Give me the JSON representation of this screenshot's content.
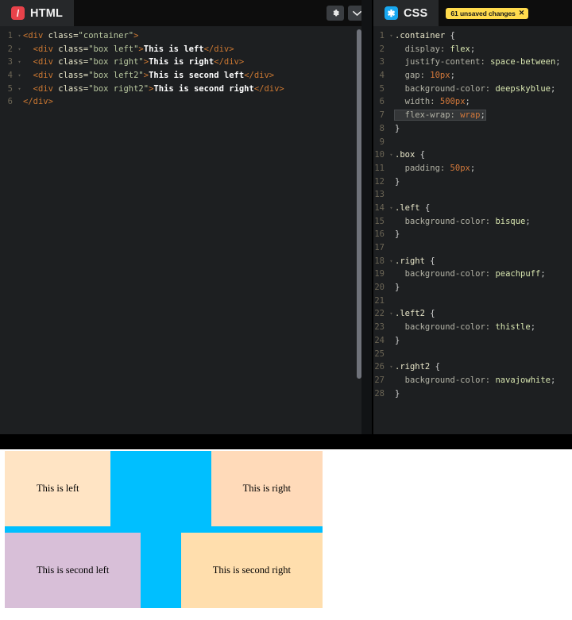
{
  "editors": {
    "html_panel": {
      "tab_label": "HTML",
      "logo_glyph": "/",
      "buttons": [
        {
          "name": "settings",
          "icon": "gear-icon"
        },
        {
          "name": "collapse",
          "icon": "chevron-down-icon"
        }
      ],
      "lines": [
        {
          "num": "1",
          "fold": "▾",
          "tokens": [
            {
              "cls": "t-tag",
              "text": "<div "
            },
            {
              "cls": "t-attr",
              "text": "class="
            },
            {
              "cls": "t-string",
              "text": "\"container\""
            },
            {
              "cls": "t-tag",
              "text": ">"
            }
          ]
        },
        {
          "num": "2",
          "fold": "▾",
          "tokens": [
            {
              "cls": "t-tag",
              "text": "  <div "
            },
            {
              "cls": "t-attr",
              "text": "class="
            },
            {
              "cls": "t-string",
              "text": "\"box left\""
            },
            {
              "cls": "t-tag",
              "text": ">"
            },
            {
              "cls": "t-text",
              "text": "This is left"
            },
            {
              "cls": "t-tag",
              "text": "</div>"
            }
          ]
        },
        {
          "num": "3",
          "fold": "▾",
          "tokens": [
            {
              "cls": "t-tag",
              "text": "  <div "
            },
            {
              "cls": "t-attr",
              "text": "class="
            },
            {
              "cls": "t-string",
              "text": "\"box right\""
            },
            {
              "cls": "t-tag",
              "text": ">"
            },
            {
              "cls": "t-text",
              "text": "This is right"
            },
            {
              "cls": "t-tag",
              "text": "</div>"
            }
          ]
        },
        {
          "num": "4",
          "fold": "▾",
          "tokens": [
            {
              "cls": "t-tag",
              "text": "  <div "
            },
            {
              "cls": "t-attr",
              "text": "class="
            },
            {
              "cls": "t-string",
              "text": "\"box left2\""
            },
            {
              "cls": "t-tag",
              "text": ">"
            },
            {
              "cls": "t-text",
              "text": "This is second left"
            },
            {
              "cls": "t-tag",
              "text": "</div>"
            }
          ]
        },
        {
          "num": "5",
          "fold": "▾",
          "tokens": [
            {
              "cls": "t-tag",
              "text": "  <div "
            },
            {
              "cls": "t-attr",
              "text": "class="
            },
            {
              "cls": "t-string",
              "text": "\"box right2\""
            },
            {
              "cls": "t-tag",
              "text": ">"
            },
            {
              "cls": "t-text",
              "text": "This is second right"
            },
            {
              "cls": "t-tag",
              "text": "</div>"
            }
          ]
        },
        {
          "num": "6",
          "fold": "",
          "tokens": [
            {
              "cls": "t-tag",
              "text": "</div>"
            }
          ]
        }
      ]
    },
    "css_panel": {
      "tab_label": "CSS",
      "logo_glyph": "✱",
      "unsaved_badge": {
        "text": "61 unsaved changes",
        "close": "✕",
        "color": "#ffdb4d"
      },
      "lines": [
        {
          "num": "1",
          "fold": "▾",
          "tokens": [
            {
              "cls": "t-sel",
              "text": ".container "
            },
            {
              "cls": "t-brace",
              "text": "{"
            }
          ]
        },
        {
          "num": "2",
          "fold": "",
          "tokens": [
            {
              "cls": "t-prop",
              "text": "  display: "
            },
            {
              "cls": "t-value",
              "text": "flex"
            },
            {
              "cls": "t-punct",
              "text": ";"
            }
          ]
        },
        {
          "num": "3",
          "fold": "",
          "tokens": [
            {
              "cls": "t-prop",
              "text": "  justify-content: "
            },
            {
              "cls": "t-value",
              "text": "space-between"
            },
            {
              "cls": "t-punct",
              "text": ";"
            }
          ]
        },
        {
          "num": "4",
          "fold": "",
          "tokens": [
            {
              "cls": "t-prop",
              "text": "  gap: "
            },
            {
              "cls": "t-num",
              "text": "10px"
            },
            {
              "cls": "t-punct",
              "text": ";"
            }
          ]
        },
        {
          "num": "5",
          "fold": "",
          "tokens": [
            {
              "cls": "t-prop",
              "text": "  background-color: "
            },
            {
              "cls": "t-value",
              "text": "deepskyblue"
            },
            {
              "cls": "t-punct",
              "text": ";"
            }
          ]
        },
        {
          "num": "6",
          "fold": "",
          "tokens": [
            {
              "cls": "t-prop",
              "text": "  width: "
            },
            {
              "cls": "t-num",
              "text": "500px"
            },
            {
              "cls": "t-punct",
              "text": ";"
            }
          ]
        },
        {
          "num": "7",
          "fold": "",
          "highlight": true,
          "tokens": [
            {
              "cls": "t-prop",
              "text": "  flex-wrap: "
            },
            {
              "cls": "t-num",
              "text": "wrap"
            },
            {
              "cls": "t-punct",
              "text": ";"
            }
          ]
        },
        {
          "num": "8",
          "fold": "",
          "tokens": [
            {
              "cls": "t-brace",
              "text": "}"
            }
          ]
        },
        {
          "num": "9",
          "fold": "",
          "tokens": []
        },
        {
          "num": "10",
          "fold": "▾",
          "tokens": [
            {
              "cls": "t-sel",
              "text": ".box "
            },
            {
              "cls": "t-brace",
              "text": "{"
            }
          ]
        },
        {
          "num": "11",
          "fold": "",
          "tokens": [
            {
              "cls": "t-prop",
              "text": "  padding: "
            },
            {
              "cls": "t-num",
              "text": "50px"
            },
            {
              "cls": "t-punct",
              "text": ";"
            }
          ]
        },
        {
          "num": "12",
          "fold": "",
          "tokens": [
            {
              "cls": "t-brace",
              "text": "}"
            }
          ]
        },
        {
          "num": "13",
          "fold": "",
          "tokens": []
        },
        {
          "num": "14",
          "fold": "▾",
          "tokens": [
            {
              "cls": "t-sel",
              "text": ".left "
            },
            {
              "cls": "t-brace",
              "text": "{"
            }
          ]
        },
        {
          "num": "15",
          "fold": "",
          "tokens": [
            {
              "cls": "t-prop",
              "text": "  background-color: "
            },
            {
              "cls": "t-value",
              "text": "bisque"
            },
            {
              "cls": "t-punct",
              "text": ";"
            }
          ]
        },
        {
          "num": "16",
          "fold": "",
          "tokens": [
            {
              "cls": "t-brace",
              "text": "}"
            }
          ]
        },
        {
          "num": "17",
          "fold": "",
          "tokens": []
        },
        {
          "num": "18",
          "fold": "▾",
          "tokens": [
            {
              "cls": "t-sel",
              "text": ".right "
            },
            {
              "cls": "t-brace",
              "text": "{"
            }
          ]
        },
        {
          "num": "19",
          "fold": "",
          "tokens": [
            {
              "cls": "t-prop",
              "text": "  background-color: "
            },
            {
              "cls": "t-value",
              "text": "peachpuff"
            },
            {
              "cls": "t-punct",
              "text": ";"
            }
          ]
        },
        {
          "num": "20",
          "fold": "",
          "tokens": [
            {
              "cls": "t-brace",
              "text": "}"
            }
          ]
        },
        {
          "num": "21",
          "fold": "",
          "tokens": []
        },
        {
          "num": "22",
          "fold": "▾",
          "tokens": [
            {
              "cls": "t-sel",
              "text": ".left2 "
            },
            {
              "cls": "t-brace",
              "text": "{"
            }
          ]
        },
        {
          "num": "23",
          "fold": "",
          "tokens": [
            {
              "cls": "t-prop",
              "text": "  background-color: "
            },
            {
              "cls": "t-value",
              "text": "thistle"
            },
            {
              "cls": "t-punct",
              "text": ";"
            }
          ]
        },
        {
          "num": "24",
          "fold": "",
          "tokens": [
            {
              "cls": "t-brace",
              "text": "}"
            }
          ]
        },
        {
          "num": "25",
          "fold": "",
          "tokens": []
        },
        {
          "num": "26",
          "fold": "▾",
          "tokens": [
            {
              "cls": "t-sel",
              "text": ".right2 "
            },
            {
              "cls": "t-brace",
              "text": "{"
            }
          ]
        },
        {
          "num": "27",
          "fold": "",
          "tokens": [
            {
              "cls": "t-prop",
              "text": "  background-color: "
            },
            {
              "cls": "t-value",
              "text": "navajowhite"
            },
            {
              "cls": "t-punct",
              "text": ";"
            }
          ]
        },
        {
          "num": "28",
          "fold": "",
          "tokens": [
            {
              "cls": "t-brace",
              "text": "}"
            }
          ]
        }
      ]
    }
  },
  "preview": {
    "container_color": "#00bfff",
    "boxes": [
      {
        "label": "This is left",
        "cls": "left",
        "color": "#ffe4c4"
      },
      {
        "label": "This is right",
        "cls": "right",
        "color": "#ffdab9"
      },
      {
        "label": "This is second left",
        "cls": "left2",
        "color": "#d8bfd8"
      },
      {
        "label": "This is second right",
        "cls": "right2",
        "color": "#ffdead"
      }
    ]
  }
}
